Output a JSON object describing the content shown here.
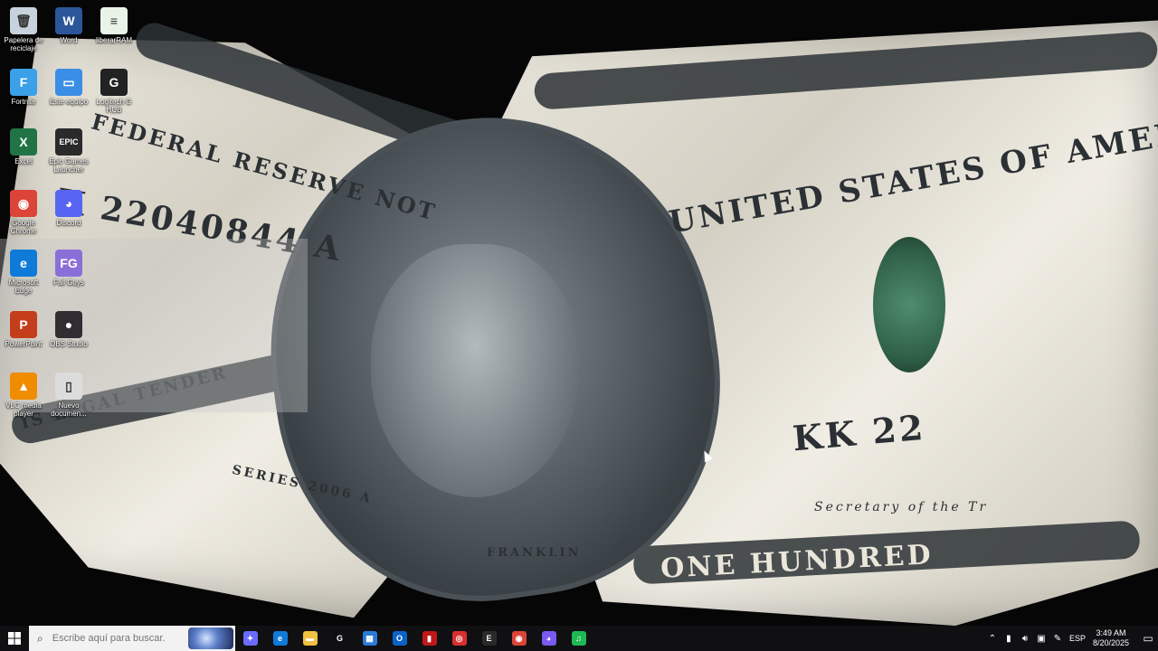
{
  "wallpaper": {
    "engravings": {
      "federal": "FEDERAL RESERVE NOT",
      "united": "UNITED STATES OF AMERICA",
      "serial_left": "K 22040844 A",
      "serial_right": "KK 22",
      "one_hundred": "ONE HUNDRED",
      "legal": "IS LEGAL TENDER",
      "series": "SERIES 2006 A",
      "secretary": "Secretary of the Tr",
      "franklin": "FRANKLIN"
    }
  },
  "desktop_icons": [
    {
      "label": "Papelera de reciclaje",
      "glyph": "🗑",
      "color": "#c8d2dc",
      "icon": "recycle-bin-icon"
    },
    {
      "label": "Word",
      "glyph": "W",
      "color": "#2b579a",
      "icon": "word-icon"
    },
    {
      "label": "liberarRAM",
      "glyph": "≡",
      "color": "#e8f4e8",
      "icon": "script-file-icon"
    },
    {
      "label": "Fortnite",
      "glyph": "F",
      "color": "#3aa0e8",
      "icon": "fortnite-icon"
    },
    {
      "label": "Este equipo",
      "glyph": "▭",
      "color": "#3a8ee6",
      "icon": "this-pc-icon"
    },
    {
      "label": "Logitech G HUB",
      "glyph": "G",
      "color": "#222222",
      "icon": "logitech-icon"
    },
    {
      "label": "Excel",
      "glyph": "X",
      "color": "#217346",
      "icon": "excel-icon"
    },
    {
      "label": "Epic Games Launcher",
      "glyph": "EPIC",
      "color": "#2a2a2a",
      "icon": "epic-games-icon"
    },
    {
      "label": "Google Chrome",
      "glyph": "◉",
      "color": "#db4437",
      "icon": "chrome-icon"
    },
    {
      "label": "Discord",
      "glyph": "◕",
      "color": "#5865f2",
      "icon": "discord-icon"
    },
    {
      "label": "Microsoft Edge",
      "glyph": "e",
      "color": "#0f7bd8",
      "icon": "edge-icon"
    },
    {
      "label": "Fall Guys",
      "glyph": "FG",
      "color": "#8a6fd8",
      "icon": "fall-guys-icon"
    },
    {
      "label": "PowerPoint",
      "glyph": "P",
      "color": "#c43e1c",
      "icon": "powerpoint-icon"
    },
    {
      "label": "OBS Studio",
      "glyph": "●",
      "color": "#302e31",
      "icon": "obs-icon"
    },
    {
      "label": "VLC media player",
      "glyph": "▲",
      "color": "#f08c00",
      "icon": "vlc-icon"
    },
    {
      "label": "Nuevo documen...",
      "glyph": "▯",
      "color": "#dcdcdc",
      "icon": "text-document-icon"
    }
  ],
  "taskbar": {
    "search_placeholder": "Escribe aquí para buscar.",
    "apps": [
      {
        "icon": "copilot-icon",
        "glyph": "✦",
        "color": "#6b6bff"
      },
      {
        "icon": "edge-icon",
        "glyph": "e",
        "color": "#0f7bd8"
      },
      {
        "icon": "file-explorer-icon",
        "glyph": "▬",
        "color": "#f0c040"
      },
      {
        "icon": "logitech-icon",
        "glyph": "G",
        "color": "#101013"
      },
      {
        "icon": "microsoft-store-icon",
        "glyph": "▦",
        "color": "#2a7bd8"
      },
      {
        "icon": "outlook-icon",
        "glyph": "O",
        "color": "#0a64c8"
      },
      {
        "icon": "powerpoint-pdf-icon",
        "glyph": "▮",
        "color": "#c01818"
      },
      {
        "icon": "screen-recorder-icon",
        "glyph": "◎",
        "color": "#d83030"
      },
      {
        "icon": "epic-games-icon",
        "glyph": "E",
        "color": "#2a2a2a"
      },
      {
        "icon": "chrome-icon",
        "glyph": "◉",
        "color": "#db4437"
      },
      {
        "icon": "discord-canary-icon",
        "glyph": "◕",
        "color": "#7a5af0"
      },
      {
        "icon": "spotify-icon",
        "glyph": "♫",
        "color": "#1db954"
      }
    ],
    "tray": {
      "language": "ESP",
      "time": "3:49 AM",
      "date": "8/20/2025"
    }
  }
}
